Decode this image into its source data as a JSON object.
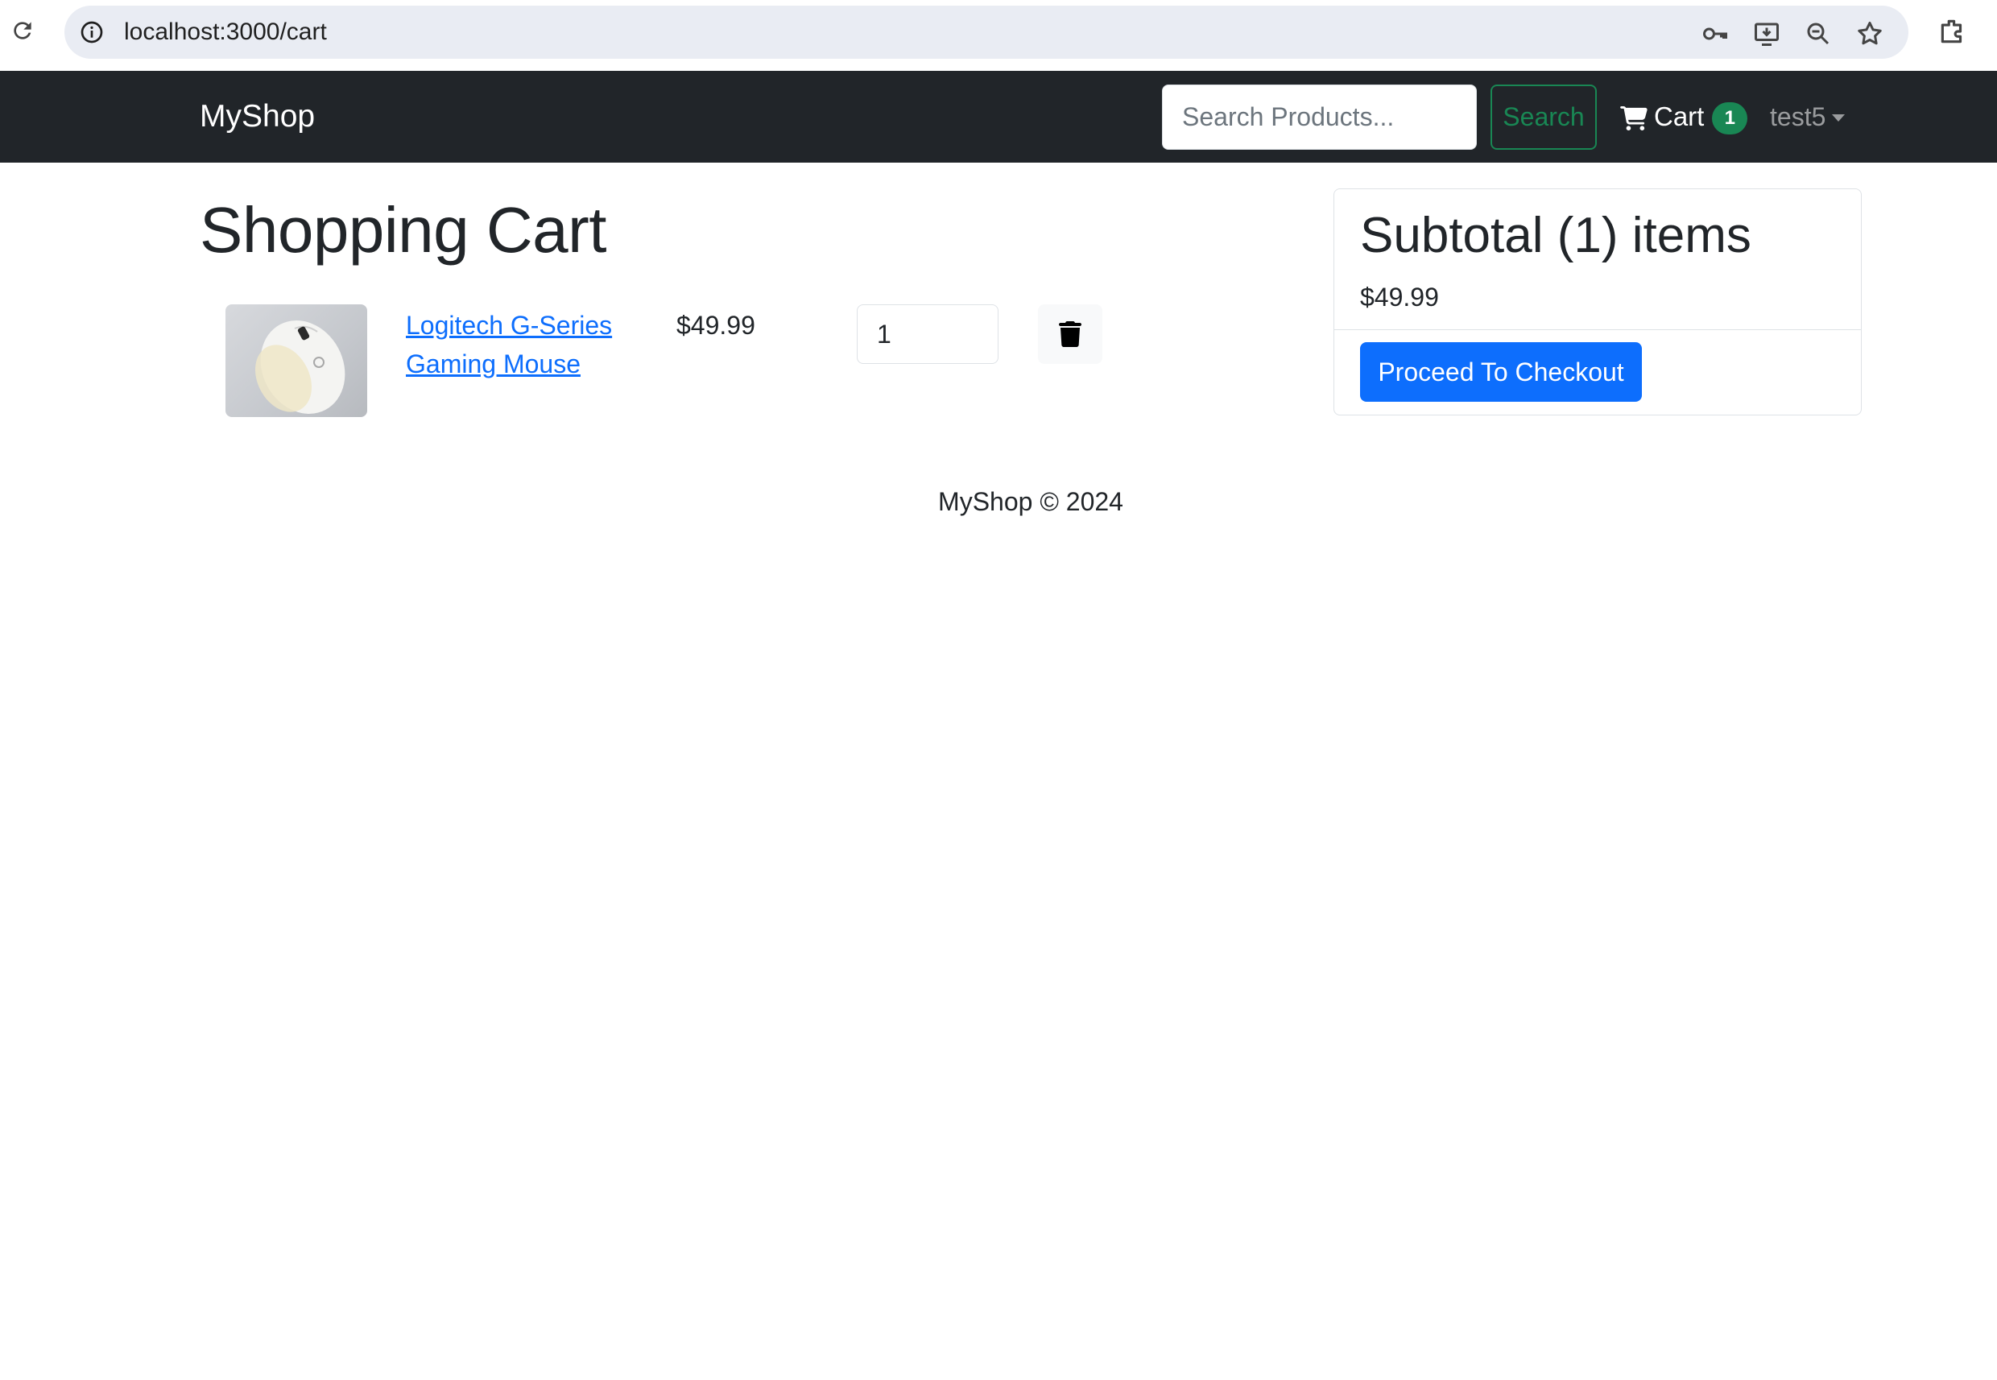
{
  "browser": {
    "url": "localhost:3000/cart"
  },
  "navbar": {
    "brand": "MyShop",
    "search_placeholder": "Search Products...",
    "search_button": "Search",
    "cart_label": "Cart",
    "cart_count": "1",
    "user_name": "test5"
  },
  "cart": {
    "title": "Shopping Cart",
    "items": [
      {
        "name": "Logitech G-Series Gaming Mouse",
        "price": "$49.99",
        "quantity": "1"
      }
    ]
  },
  "summary": {
    "title": "Subtotal (1) items",
    "total": "$49.99",
    "checkout_button": "Proceed To Checkout"
  },
  "footer": {
    "text": "MyShop © 2024"
  },
  "colors": {
    "navbar_bg": "#212529",
    "primary": "#0d6efd",
    "success": "#198754"
  }
}
